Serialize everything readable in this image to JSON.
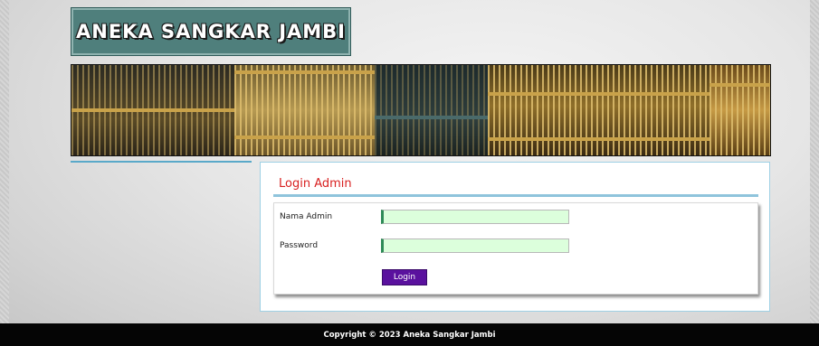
{
  "header": {
    "site_title": "ANEKA SANGKAR JAMBI"
  },
  "login_panel": {
    "title": "Login Admin",
    "fields": [
      {
        "label": "Nama Admin",
        "value": "",
        "placeholder": ""
      },
      {
        "label": "Password",
        "value": "",
        "placeholder": ""
      }
    ],
    "submit_label": "Login"
  },
  "footer": {
    "copyright": "Copyright © 2023 Aneka Sangkar Jambi"
  },
  "colors": {
    "logo_bg": "#4f7f7c",
    "accent_blue": "#8fc4dc",
    "title_red": "#d82020",
    "input_bg": "#dcffdc",
    "button_purple": "#5a119e",
    "footer_bg": "#050505"
  }
}
